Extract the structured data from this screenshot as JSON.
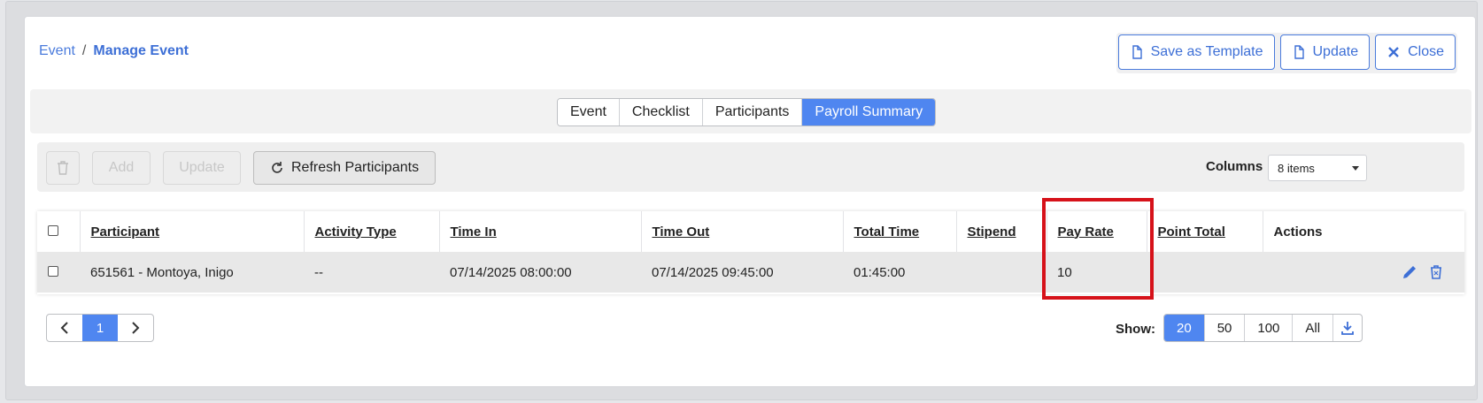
{
  "breadcrumb": {
    "root": "Event",
    "separator": "/",
    "current": "Manage Event"
  },
  "header_actions": {
    "save_template": "Save as Template",
    "update": "Update",
    "close": "Close"
  },
  "tabs": [
    {
      "label": "Event"
    },
    {
      "label": "Checklist"
    },
    {
      "label": "Participants"
    },
    {
      "label": "Payroll Summary",
      "active": true
    }
  ],
  "toolbar": {
    "add": "Add",
    "update": "Update",
    "refresh": "Refresh Participants",
    "columns_label": "Columns",
    "columns_value": "8 items"
  },
  "table": {
    "headers": [
      "Participant",
      "Activity Type",
      "Time In",
      "Time Out",
      "Total Time",
      "Stipend",
      "Pay Rate",
      "Point Total",
      "Actions"
    ],
    "rows": [
      {
        "participant": "651561 - Montoya, Inigo",
        "activity_type": "--",
        "time_in": "07/14/2025 08:00:00",
        "time_out": "07/14/2025 09:45:00",
        "total_time": "01:45:00",
        "stipend": "",
        "pay_rate": "10",
        "point_total": ""
      }
    ]
  },
  "pager": {
    "current": "1"
  },
  "show": {
    "label": "Show:",
    "options": [
      "20",
      "50",
      "100",
      "All"
    ],
    "selected": "20"
  },
  "colors": {
    "accent": "#4f86f0",
    "link": "#4a7bdc",
    "highlight": "#d6121a"
  }
}
